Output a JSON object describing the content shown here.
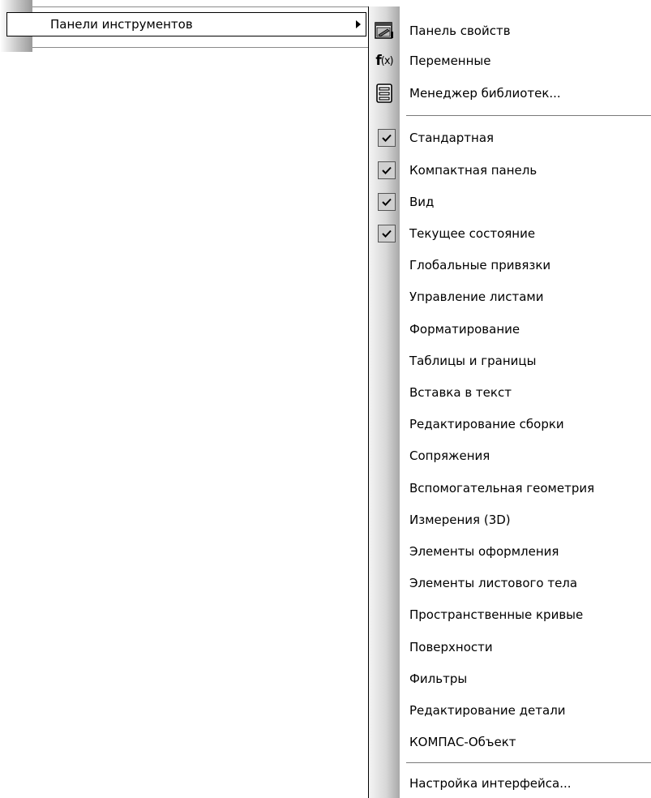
{
  "parent_menu": {
    "item_label": "Панели инструментов"
  },
  "submenu": {
    "top_items": [
      {
        "label": "Панель свойств",
        "icon": "properties-panel-icon"
      },
      {
        "label": "Переменные",
        "icon": "fx-variables-icon"
      },
      {
        "label": "Менеджер библиотек...",
        "icon": "library-manager-icon"
      }
    ],
    "toolbars": [
      {
        "label": "Стандартная",
        "checked": true
      },
      {
        "label": "Компактная панель",
        "checked": true
      },
      {
        "label": "Вид",
        "checked": true
      },
      {
        "label": "Текущее состояние",
        "checked": true
      },
      {
        "label": "Глобальные привязки",
        "checked": false
      },
      {
        "label": "Управление листами",
        "checked": false
      },
      {
        "label": "Форматирование",
        "checked": false
      },
      {
        "label": "Таблицы и границы",
        "checked": false
      },
      {
        "label": "Вставка в текст",
        "checked": false
      },
      {
        "label": "Редактирование сборки",
        "checked": false
      },
      {
        "label": "Сопряжения",
        "checked": false
      },
      {
        "label": "Вспомогательная геометрия",
        "checked": false
      },
      {
        "label": "Измерения (3D)",
        "checked": false
      },
      {
        "label": "Элементы оформления",
        "checked": false
      },
      {
        "label": "Элементы листового тела",
        "checked": false
      },
      {
        "label": "Пространственные кривые",
        "checked": false
      },
      {
        "label": "Поверхности",
        "checked": false
      },
      {
        "label": "Фильтры",
        "checked": false
      },
      {
        "label": "Редактирование детали",
        "checked": false
      },
      {
        "label": "КОМПАС-Объект",
        "checked": false
      }
    ],
    "bottom_item": {
      "label": "Настройка интерфейса..."
    }
  }
}
